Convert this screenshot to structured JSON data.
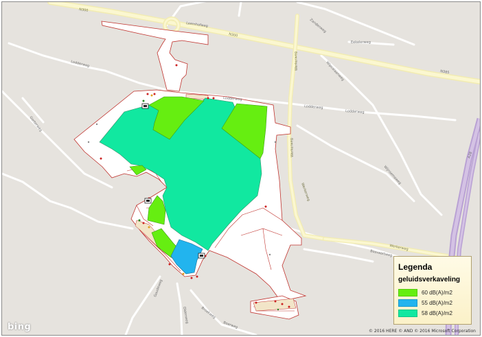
{
  "legend": {
    "title": "Legenda",
    "subtitle": "geluidsverkaveling",
    "items": [
      {
        "label": "60 dB(A)/m2",
        "color": "#66ee11"
      },
      {
        "label": "55 dB(A)/m2",
        "color": "#22b4ee"
      },
      {
        "label": "58 dB(A)/m2",
        "color": "#11e8a0"
      }
    ]
  },
  "logo": {
    "text": "bing"
  },
  "copyright": "© 2016 HERE © AND © 2016 Microsoft Corporation",
  "roads": {
    "n300": "N300",
    "n300b": "N300",
    "leemhofweg": "Leemhofweg",
    "zandenweg": "Zandenweg",
    "eekelerweg": "Eekelerweg",
    "lodderweg_a": "Lodderweg",
    "lodderweg_b": "Lodderweg",
    "lodderweg_c": "Lodderweg",
    "lodderweg_d": "Lodderweg",
    "werkerweg_a": "Werkerweg",
    "werkerweg_b": "Werkerweg",
    "werkerweg_c": "Werkerweg",
    "wipcalaanweg": "Wipcalaanweg",
    "wijnsemadijk": "Wijnsemaweg",
    "gorterweg": "Gorterweg",
    "bosvaartweg": "Bosvaartweg",
    "n385": "N385",
    "a28": "A28",
    "goudeweg": "Goudeweg",
    "oldenweg": "Oldenweg",
    "broekweg": "Broekweg",
    "werkerweg_d": "Werkerweg",
    "boerweg": "Boerweg"
  }
}
